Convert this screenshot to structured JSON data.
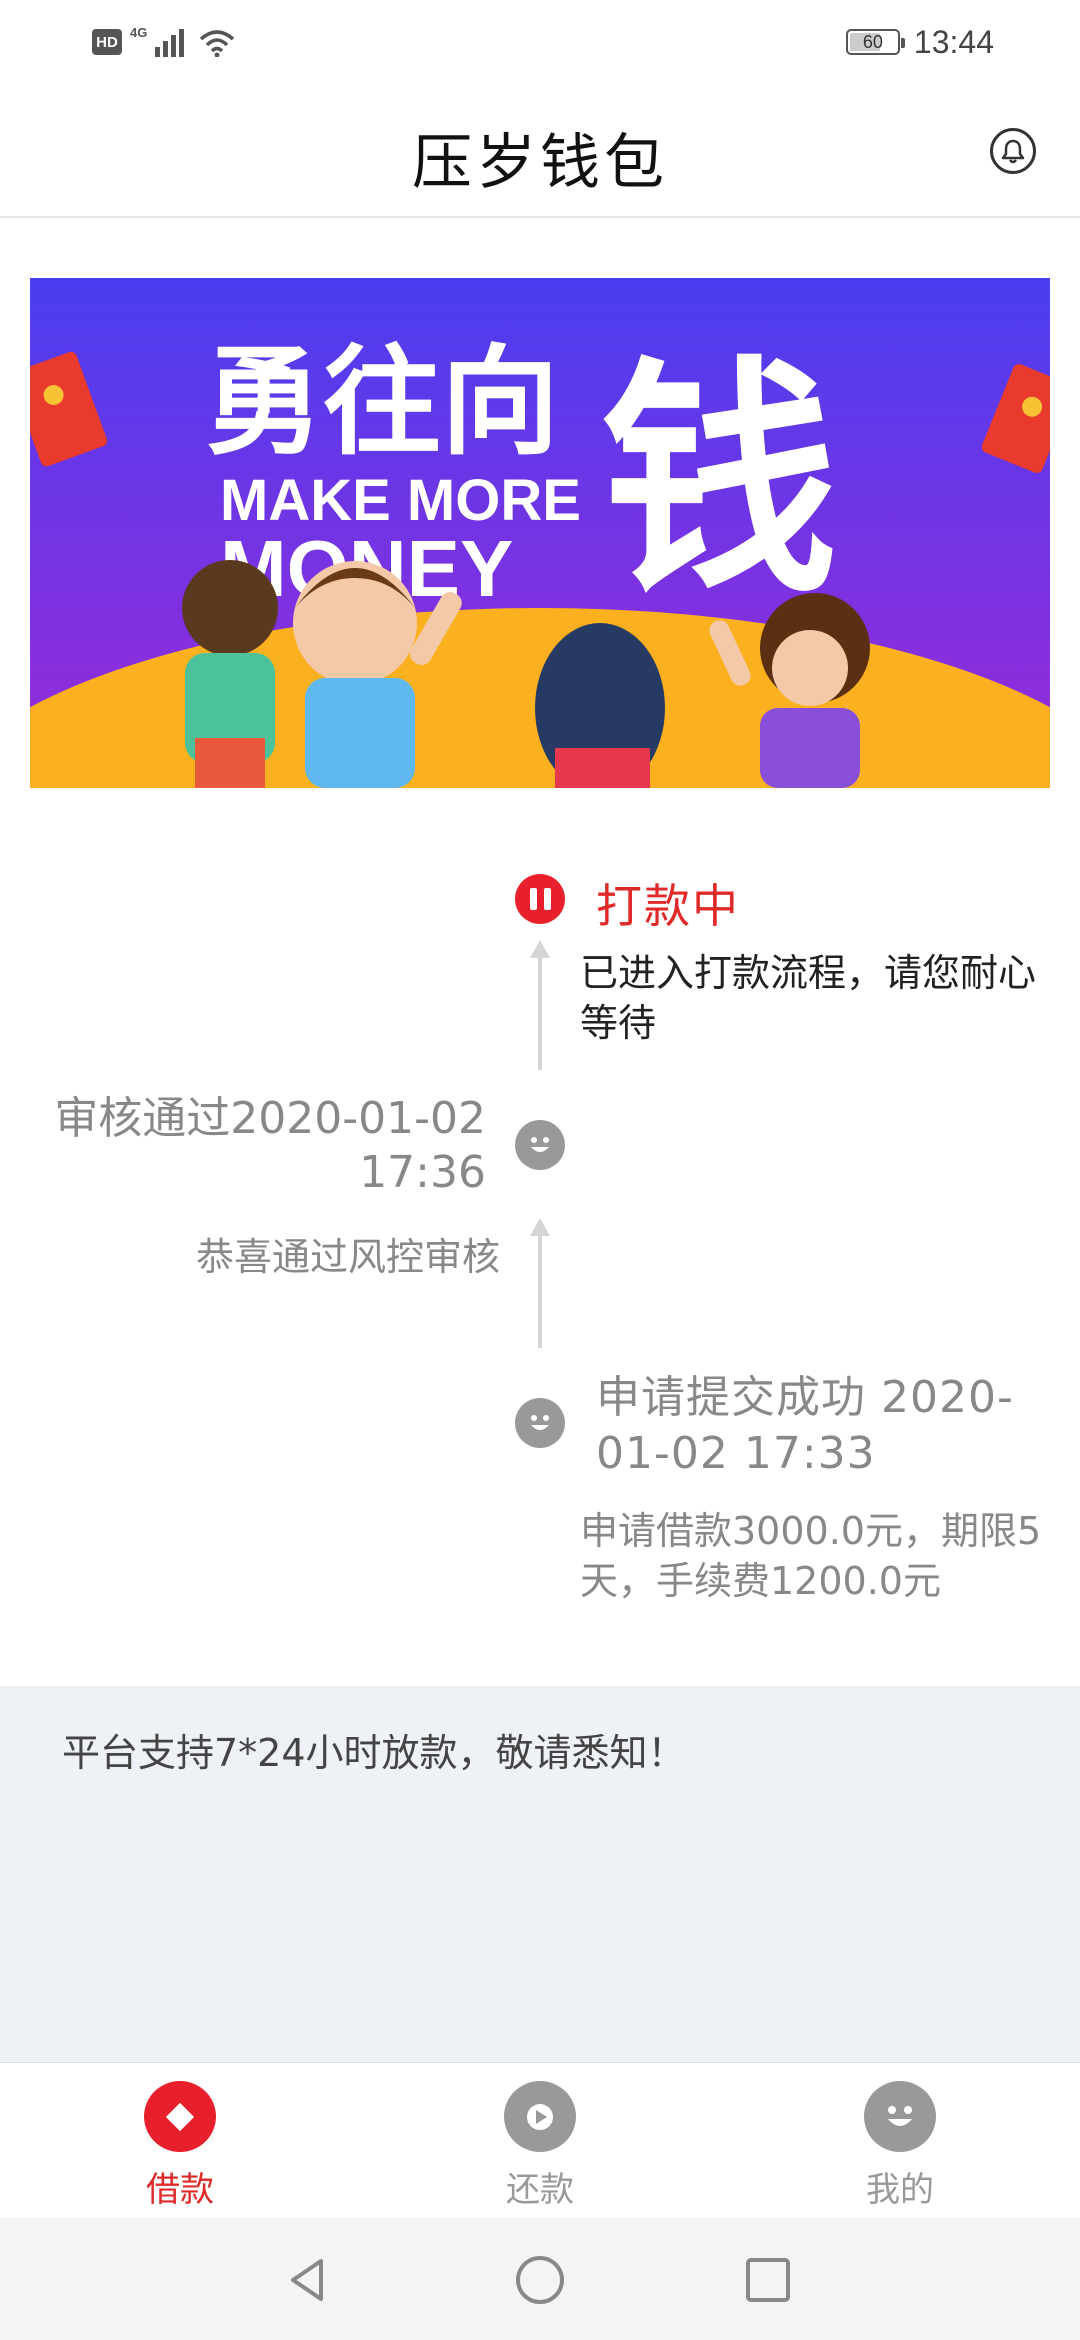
{
  "status_bar": {
    "hd": "HD",
    "network": "4G",
    "battery": "60",
    "battery_level": 0.6,
    "time": "13:44"
  },
  "header": {
    "title": "压岁钱包"
  },
  "banner": {
    "headline": "勇往向",
    "big_char": "钱",
    "subline1": "MAKE MORE",
    "subline2": "MONEY",
    "colors": {
      "bg_top": "#4a3ef0",
      "bg_bottom": "#9b2ad8",
      "ground": "#fbb11f"
    }
  },
  "timeline": {
    "steps": [
      {
        "status": "active",
        "title": "打款中",
        "desc": "已进入打款流程，请您耐心等待"
      },
      {
        "status": "done",
        "title": "审核通过2020-01-02 17:36",
        "desc": "恭喜通过风控审核"
      },
      {
        "status": "done",
        "title": "申请提交成功 2020-01-02 17:33",
        "desc": "申请借款3000.0元，期限5天，手续费1200.0元"
      }
    ],
    "colors": {
      "active": "#e8202c",
      "done": "#999999"
    }
  },
  "notice": {
    "text": "平台支持7*24小时放款，敬请悉知！"
  },
  "tabbar": {
    "items": [
      {
        "label": "借款",
        "icon": "borrow-icon",
        "active": true
      },
      {
        "label": "还款",
        "icon": "repay-icon",
        "active": false
      },
      {
        "label": "我的",
        "icon": "profile-icon",
        "active": false
      }
    ],
    "colors": {
      "active": "#e02a2a",
      "inactive": "#999999"
    }
  }
}
